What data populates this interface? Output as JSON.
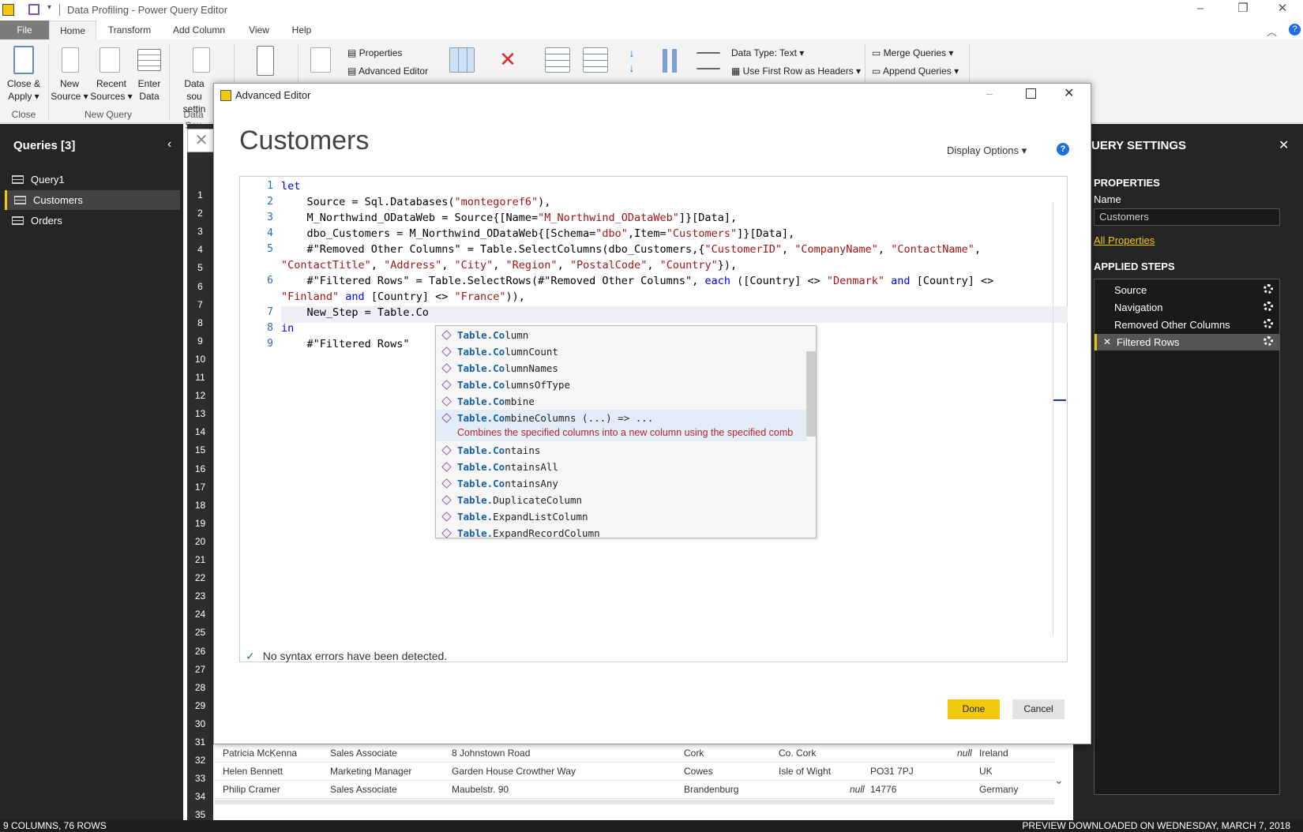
{
  "window": {
    "title": "Data Profiling - Power Query Editor"
  },
  "tabs": [
    "File",
    "Home",
    "Transform",
    "Add Column",
    "View",
    "Help"
  ],
  "ribbon": {
    "close_apply": "Close &",
    "close_apply2": "Apply",
    "new_source": "New",
    "new_source2": "Source",
    "recent_sources": "Recent",
    "recent_sources2": "Sources",
    "enter_data": "Enter",
    "enter_data2": "Data",
    "data_source": "Data sou",
    "data_source2": "settin",
    "properties": "Properties",
    "advanced_editor": "Advanced Editor",
    "data_type": "Data Type: Text",
    "first_row_headers": "Use First Row as Headers",
    "merge_queries": "Merge Queries",
    "append_queries": "Append Queries",
    "groups": {
      "close": "Close",
      "new_query": "New Query",
      "data_sources": "Data Sou"
    }
  },
  "queries": {
    "header": "Queries [3]",
    "items": [
      "Query1",
      "Customers",
      "Orders"
    ]
  },
  "row_numbers": [
    "1",
    "2",
    "3",
    "4",
    "5",
    "6",
    "7",
    "8",
    "9",
    "10",
    "11",
    "12",
    "13",
    "14",
    "15",
    "16",
    "17",
    "18",
    "19",
    "20",
    "21",
    "22",
    "23",
    "24",
    "25",
    "26",
    "27",
    "28",
    "29",
    "30",
    "31",
    "32",
    "33",
    "34",
    "35"
  ],
  "bg_rows": [
    [
      "Patricia McKenna",
      "Sales Associate",
      "8 Johnstown Road",
      "Cork",
      "Co. Cork",
      "null",
      "Ireland"
    ],
    [
      "Helen Bennett",
      "Marketing Manager",
      "Garden House Crowther Way",
      "Cowes",
      "Isle of Wight",
      "PO31 7PJ",
      "UK"
    ],
    [
      "Philip Cramer",
      "Sales Associate",
      "Maubelstr. 90",
      "Brandenburg",
      "null",
      "14776",
      "Germany"
    ]
  ],
  "settings": {
    "header": "UERY SETTINGS",
    "properties": "PROPERTIES",
    "name_label": "Name",
    "name_value": "Customers",
    "all_properties": "All Properties",
    "applied_steps": "APPLIED STEPS",
    "steps": [
      "Source",
      "Navigation",
      "Removed Other Columns",
      "Filtered Rows"
    ]
  },
  "status": {
    "left": "9 COLUMNS, 76 ROWS",
    "right": "PREVIEW DOWNLOADED ON WEDNESDAY, MARCH 7, 2018"
  },
  "dialog": {
    "title": "Advanced Editor",
    "heading": "Customers",
    "display_options": "Display Options",
    "status": "No syntax errors have been detected.",
    "done": "Done",
    "cancel": "Cancel"
  },
  "autocomplete": {
    "items": [
      {
        "prefix": "Table.Co",
        "rest": "lumn"
      },
      {
        "prefix": "Table.Co",
        "rest": "lumnCount"
      },
      {
        "prefix": "Table.Co",
        "rest": "lumnNames"
      },
      {
        "prefix": "Table.Co",
        "rest": "lumnsOfType"
      },
      {
        "prefix": "Table.Co",
        "rest": "mbine"
      },
      {
        "prefix": "Table.Co",
        "rest": "mbineColumns  (...) => ..."
      },
      {
        "prefix": "Table.Co",
        "rest": "ntains"
      },
      {
        "prefix": "Table.Co",
        "rest": "ntainsAll"
      },
      {
        "prefix": "Table.Co",
        "rest": "ntainsAny"
      },
      {
        "prefix": "Table.",
        "rest": "DuplicateColumn"
      },
      {
        "prefix": "Table.",
        "rest": "ExpandListColumn"
      },
      {
        "prefix": "Table.",
        "rest": "ExpandRecordColumn"
      }
    ],
    "description": "Combines the specified columns into a new column using the specified comb"
  }
}
